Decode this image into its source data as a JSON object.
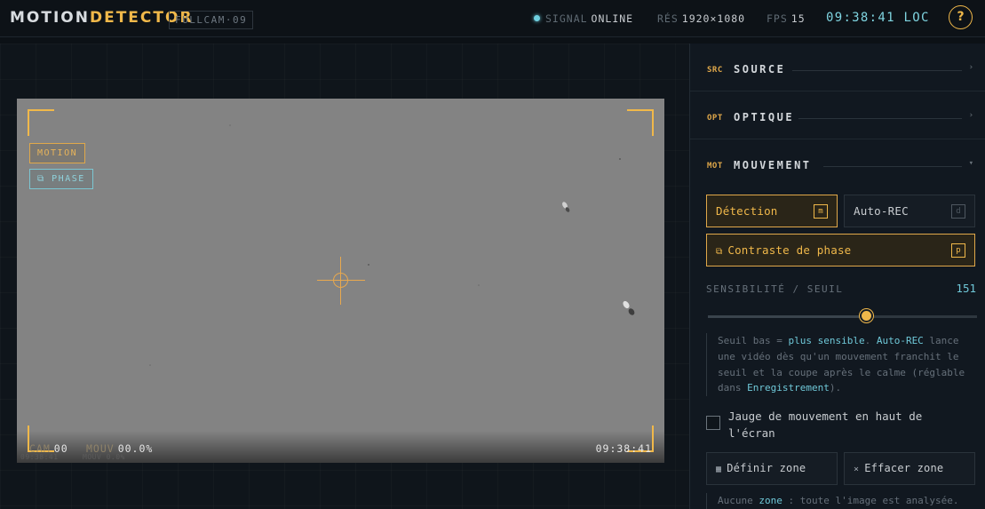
{
  "header": {
    "brand_part1": "MOTION",
    "brand_part2": "DETECTOR",
    "camera_tag": "FULLCAM·09",
    "signal_key": "SIGNAL",
    "signal_value": "ONLINE",
    "res_key": "RÉS",
    "res_value": "1920×1080",
    "fps_key": "FPS",
    "fps_value": "15",
    "clock": "09:38:41 LOC",
    "help_label": "?"
  },
  "feed": {
    "badge_motion": "MOTION",
    "badge_phase": "⧉ PHASE",
    "info_cam_key": "CAM",
    "info_cam_value": "00",
    "info_mouv_key": "MOUV",
    "info_mouv_value": "00.0%",
    "ghost_left": "09:38:41",
    "ghost_mid": "MOUV 0.0%",
    "time": "09:38:41"
  },
  "panel": {
    "source": {
      "code": "SRC",
      "title": "SOURCE",
      "arrow": "›"
    },
    "optique": {
      "code": "OPT",
      "title": "OPTIQUE",
      "arrow": "›"
    },
    "mouvement": {
      "code": "MOT",
      "title": "MOUVEMENT",
      "arrow": "▾",
      "detection_label": "Détection",
      "detection_key": "m",
      "autorec_label": "Auto-REC",
      "autorec_key": "d",
      "phase_icon": "⧉",
      "phase_label": "Contraste de phase",
      "phase_key": "p",
      "sensitivity_label": "SENSIBILITÉ / SEUIL",
      "sensitivity_value": "151",
      "sensitivity_fraction": 0.587,
      "note1": {
        "t1": "Seuil bas = ",
        "h1": "plus sensible",
        "t2": ". ",
        "h2": "Auto-REC",
        "t3": " lance une vidéo dès qu'un mouvement franchit le seuil et la coupe après le calme (réglable dans ",
        "h3": "Enregistrement",
        "t4": ")."
      },
      "gauge_checkbox_label": "Jauge de mouvement en haut de l'écran",
      "zone_set_icon": "▦",
      "zone_set_label": "Définir zone",
      "zone_clear_icon": "×",
      "zone_clear_label": "Effacer zone",
      "note2": {
        "t1": "Aucune ",
        "h1": "zone",
        "t2": " : toute l'image est analysée. Définissez une zone pour limiter la"
      }
    }
  },
  "colors": {
    "accent": "#f0b84a",
    "cyan": "#6fc8d8",
    "background": "#0c1116",
    "panel": "#111820"
  }
}
